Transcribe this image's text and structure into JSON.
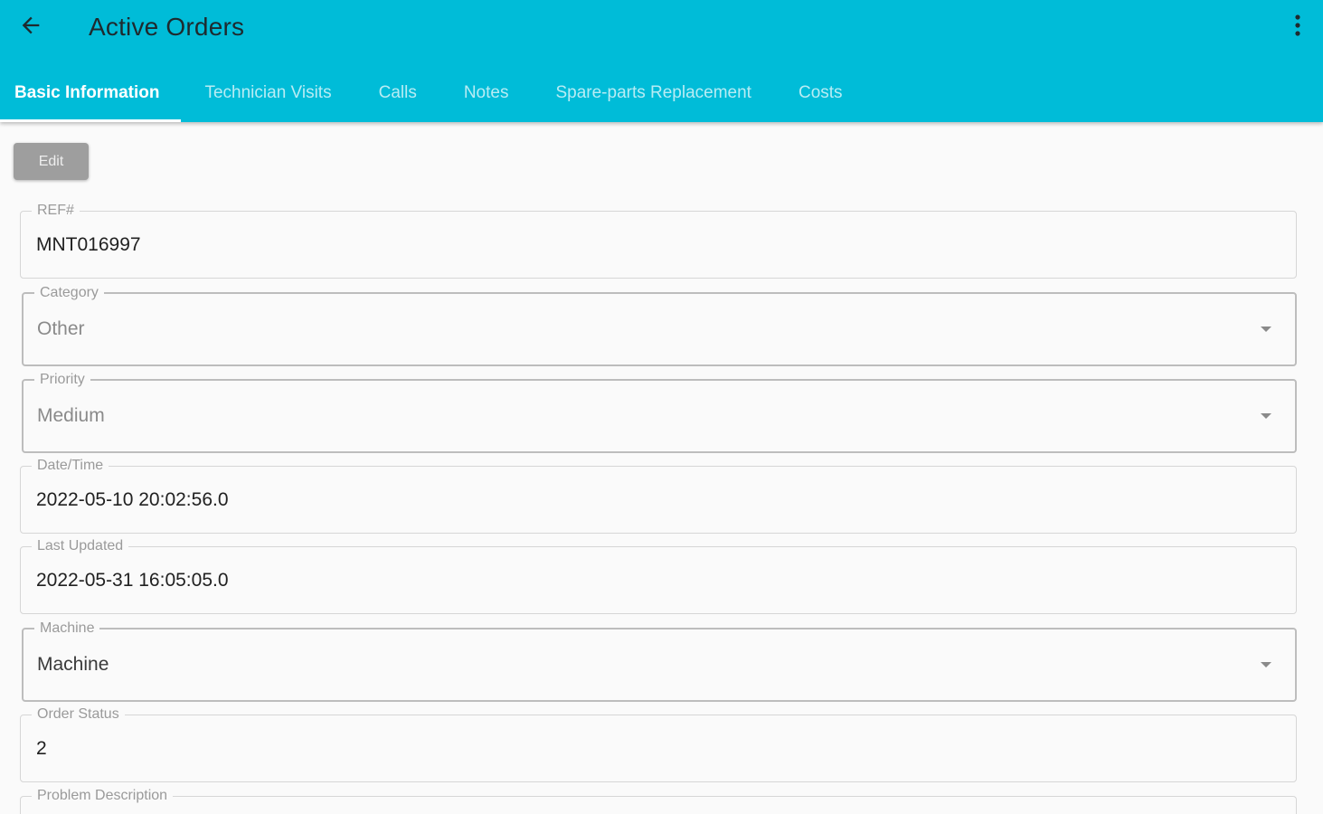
{
  "appbar": {
    "title": "Active Orders",
    "background_color": "#00bcd8",
    "back_icon": "arrow-left-icon",
    "more_icon": "more-vert-icon"
  },
  "tabs": [
    {
      "label": "Basic Information",
      "active": true
    },
    {
      "label": "Technician Visits",
      "active": false
    },
    {
      "label": "Calls",
      "active": false
    },
    {
      "label": "Notes",
      "active": false
    },
    {
      "label": "Spare-parts Replacement",
      "active": false
    },
    {
      "label": "Costs",
      "active": false
    }
  ],
  "edit_label": "Edit",
  "fields": {
    "ref": {
      "label": "REF#",
      "value": "MNT016997"
    },
    "category": {
      "label": "Category",
      "value": "Other"
    },
    "priority": {
      "label": "Priority",
      "value": "Medium"
    },
    "datetime": {
      "label": "Date/Time",
      "value": "2022-05-10 20:02:56.0"
    },
    "last_updated": {
      "label": "Last Updated",
      "value": "2022-05-31 16:05:05.0"
    },
    "machine": {
      "label": "Machine",
      "value": "Machine"
    },
    "order_status": {
      "label": "Order Status",
      "value": "2"
    },
    "problem_description": {
      "label": "Problem Description",
      "value": ""
    }
  }
}
